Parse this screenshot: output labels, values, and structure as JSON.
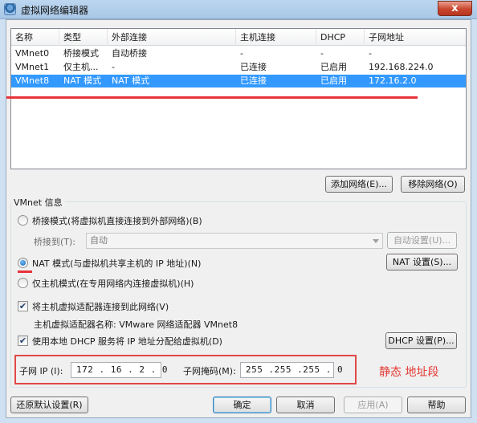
{
  "window": {
    "title": "虚拟网络编辑器",
    "close_glyph": "x"
  },
  "table": {
    "columns": [
      "名称",
      "类型",
      "外部连接",
      "主机连接",
      "DHCP",
      "子网地址"
    ],
    "rows": [
      [
        "VMnet0",
        "桥接模式",
        "自动桥接",
        "-",
        "-",
        "-"
      ],
      [
        "VMnet1",
        "仅主机...",
        "-",
        "已连接",
        "已启用",
        "192.168.224.0"
      ],
      [
        "VMnet8",
        "NAT 模式",
        "NAT 模式",
        "已连接",
        "已启用",
        "172.16.2.0"
      ]
    ],
    "selected_index": 2
  },
  "list_buttons": {
    "add": "添加网络(E)...",
    "remove": "移除网络(O)"
  },
  "vmnet_info": {
    "title": "VMnet 信息",
    "bridge_radio": "桥接模式(将虚拟机直接连接到外部网络)(B)",
    "bridge_to_label": "桥接到(T):",
    "bridge_to_value": "自动",
    "auto_settings": "自动设置(U)...",
    "nat_radio": "NAT 模式(与虚拟机共享主机的 IP 地址)(N)",
    "nat_settings": "NAT 设置(S)...",
    "host_only_radio": "仅主机模式(在专用网络内连接虚拟机)(H)",
    "connect_adapter": "将主机虚拟适配器连接到此网络(V)",
    "adapter_name": "主机虚拟适配器名称: VMware 网络适配器 VMnet8",
    "use_dhcp": "使用本地 DHCP 服务将 IP 地址分配给虚拟机(D)",
    "dhcp_settings": "DHCP 设置(P)...",
    "selected_mode": "nat",
    "connect_adapter_checked": true,
    "use_dhcp_checked": true
  },
  "subnet": {
    "ip_label": "子网 IP (I):",
    "ip_value": "172 . 16 . 2 . 0",
    "mask_label": "子网掩码(M):",
    "mask_value": "255 .255 .255 . 0",
    "annotation": "静态 地址段"
  },
  "footer": {
    "restore": "还原默认设置(R)",
    "ok": "确定",
    "cancel": "取消",
    "apply": "应用(A)",
    "help": "帮助"
  },
  "colors": {
    "selection": "#3399ff",
    "annotation_red": "#e53935"
  }
}
